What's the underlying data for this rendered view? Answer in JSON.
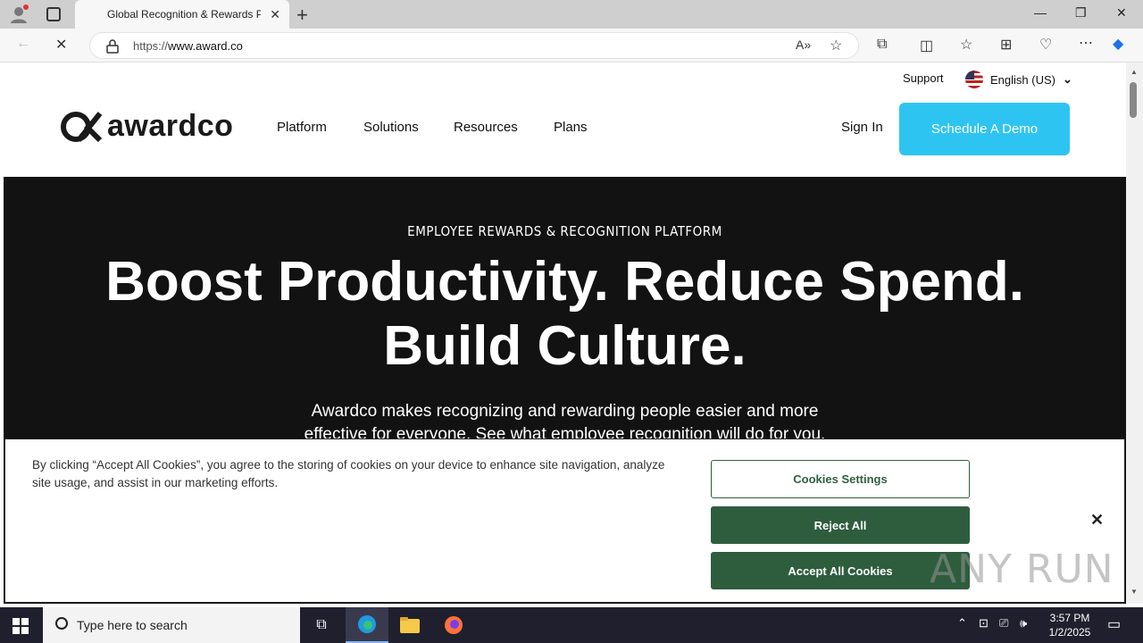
{
  "browser": {
    "tab_title": "Global Recognition & Rewards Pl",
    "url_prefix": "https://",
    "url_host": "www.award.co"
  },
  "site": {
    "support_label": "Support",
    "language_label": "English (US)",
    "logo_text": "awardco",
    "nav": [
      "Platform",
      "Solutions",
      "Resources",
      "Plans"
    ],
    "signin_label": "Sign In",
    "demo_label": "Schedule A Demo"
  },
  "hero": {
    "eyebrow": "EMPLOYEE REWARDS & RECOGNITION PLATFORM",
    "headline_line1": "Boost Productivity. Reduce Spend.",
    "headline_line2": "Build Culture.",
    "subtext": "Awardco makes recognizing and rewarding people easier and more effective for everyone. See what employee recognition will do for you."
  },
  "cookie": {
    "text": "By clicking “Accept All Cookies”, you agree to the storing of cookies on your device to enhance site navigation, analyze site usage, and assist in our marketing efforts.",
    "settings_label": "Cookies Settings",
    "reject_label": "Reject All",
    "accept_label": "Accept All Cookies",
    "close_symbol": "✕"
  },
  "watermark": "ANY RUN",
  "taskbar": {
    "search_placeholder": "Type here to search",
    "time": "3:57 PM",
    "date": "1/2/2025"
  },
  "colors": {
    "demo_button": "#2ec4f1",
    "cookie_green": "#2e5d3e",
    "hero_bg": "#121212"
  }
}
